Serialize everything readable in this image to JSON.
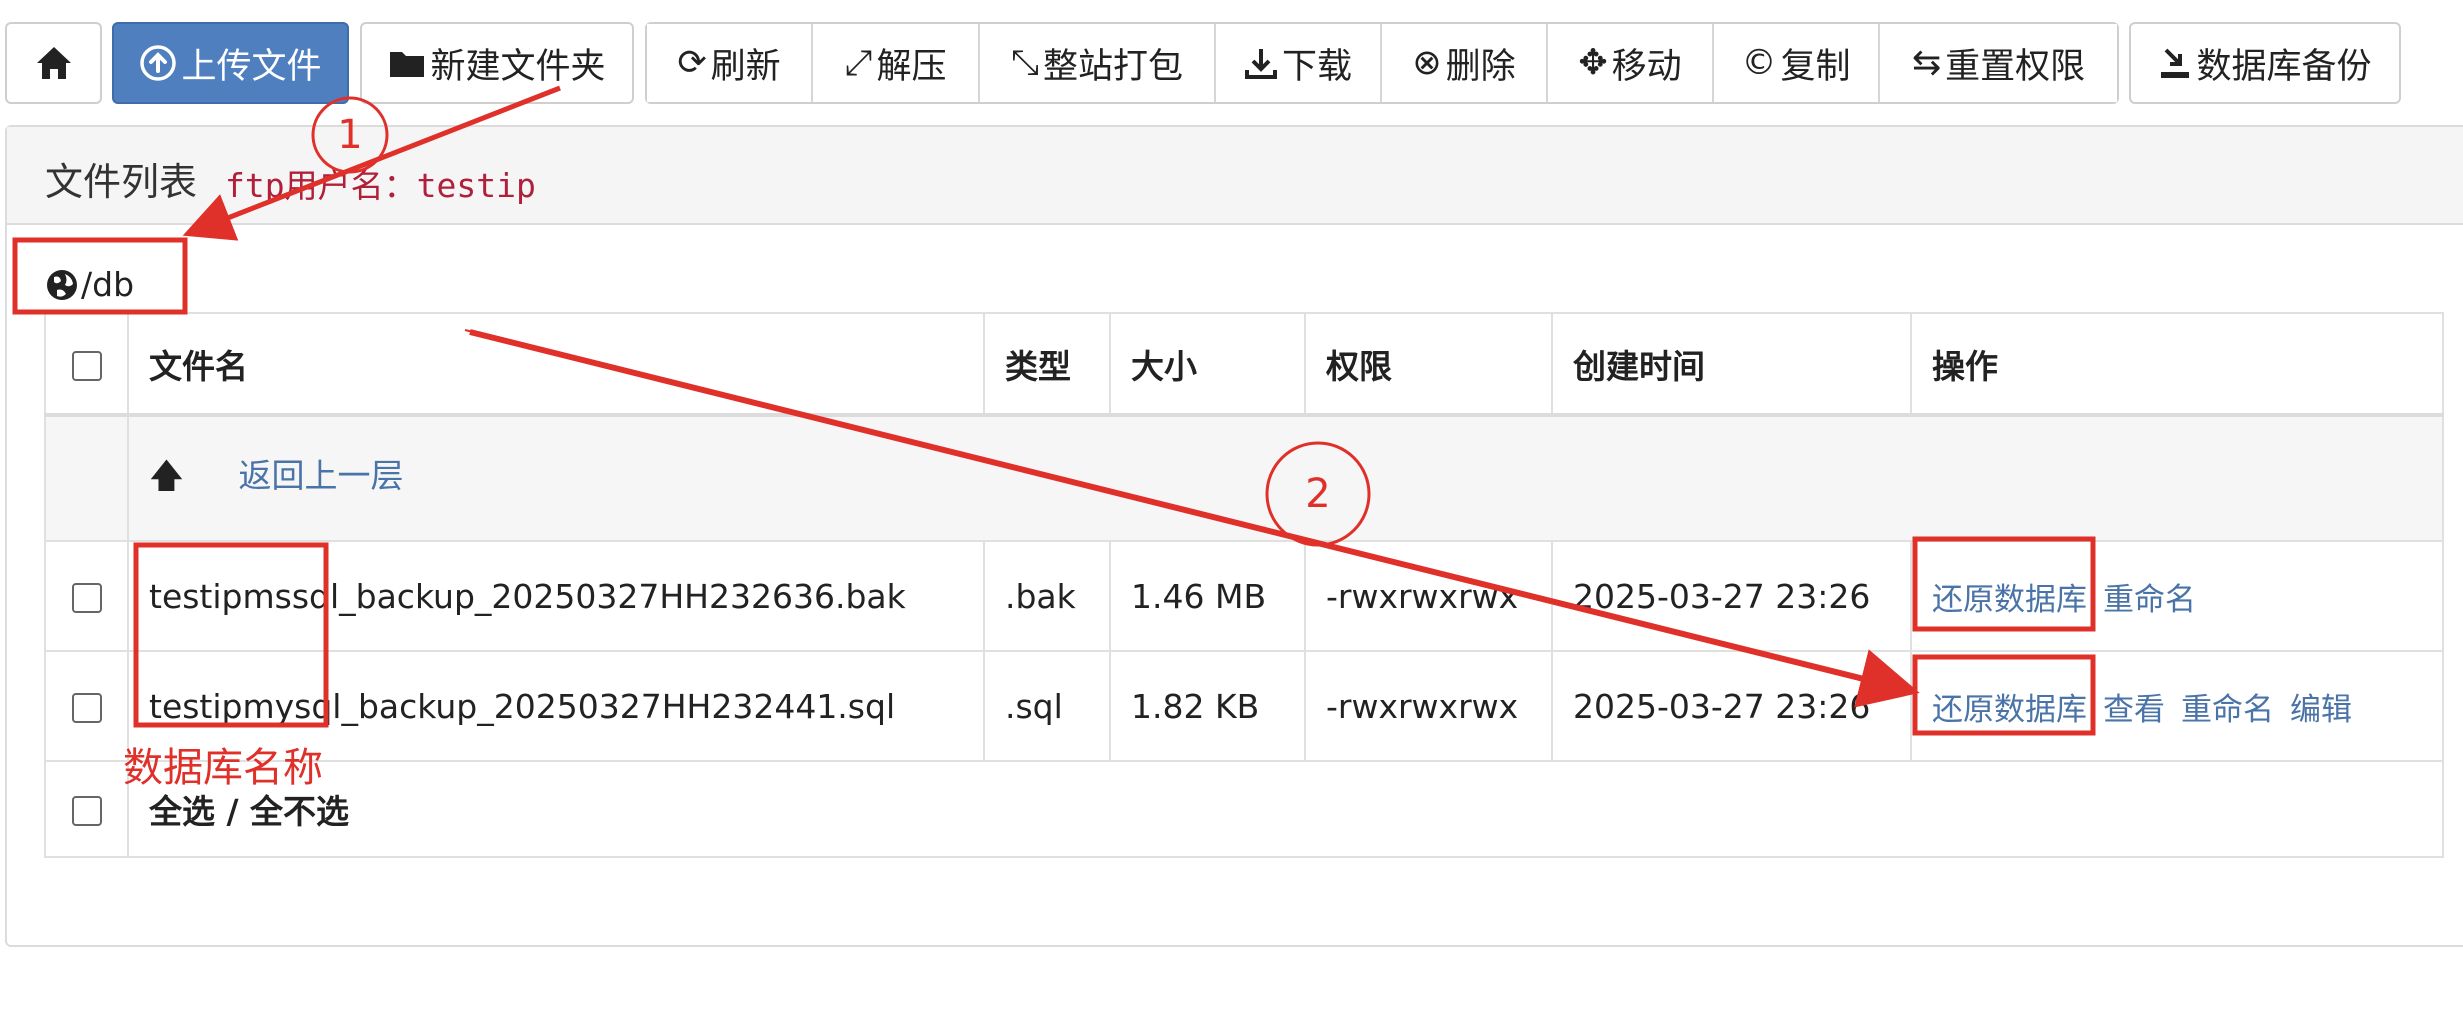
{
  "toolbar": {
    "upload": "上传文件",
    "new_folder": "新建文件夹",
    "refresh": "刷新",
    "extract": "解压",
    "pack_site": "整站打包",
    "download": "下载",
    "delete": "删除",
    "move": "移动",
    "copy": "复制",
    "reset_perm": "重置权限",
    "db_backup": "数据库备份"
  },
  "panel": {
    "title": "文件列表",
    "ftp_note": "ftp用户名：testip",
    "path": "/db"
  },
  "table": {
    "headers": [
      "文件名",
      "类型",
      "大小",
      "权限",
      "创建时间",
      "操作"
    ],
    "up_label": "返回上一层",
    "rows": [
      {
        "name": "testipmssql_backup_20250327HH232636.bak",
        "type": ".bak",
        "size": "1.46 MB",
        "perm": "-rwxrwxrwx",
        "time": "2025-03-27 23:26",
        "ops": [
          "还原数据库",
          "重命名"
        ]
      },
      {
        "name": "testipmysql_backup_20250327HH232441.sql",
        "type": ".sql",
        "size": "1.82 KB",
        "perm": "-rwxrwxrwx",
        "time": "2025-03-27 23:26",
        "ops": [
          "还原数据库",
          "查看",
          "重命名",
          "编辑"
        ]
      }
    ],
    "select_all": "全选 / 全不选"
  },
  "annotations": {
    "step1": "1",
    "step2": "2",
    "db_name_label": "数据库名称",
    "color": "#e0302a"
  },
  "colors": {
    "primary": "#4f7fbf",
    "link": "#4a73a8",
    "ftp_note": "#b0203a"
  }
}
